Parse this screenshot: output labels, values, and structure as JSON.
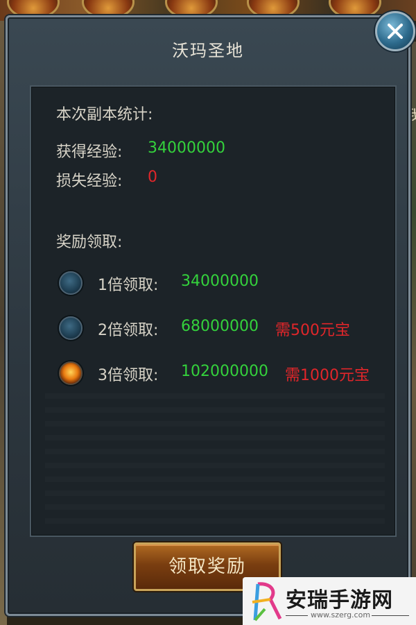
{
  "panel": {
    "title": "沃玛圣地"
  },
  "stats": {
    "heading": "本次副本统计:",
    "gained_label": "获得经验:",
    "gained_value": "34000000",
    "lost_label": "损失经验:",
    "lost_value": "0"
  },
  "rewards": {
    "heading": "奖励领取:",
    "options": [
      {
        "label": "1倍领取:",
        "value": "34000000",
        "cost": "",
        "selected": false
      },
      {
        "label": "2倍领取:",
        "value": "68000000",
        "cost": "需500元宝",
        "selected": false
      },
      {
        "label": "3倍领取:",
        "value": "102000000",
        "cost": "需1000元宝",
        "selected": true
      }
    ]
  },
  "claim_button": {
    "label": "领取奖励"
  },
  "side_text": "我",
  "watermark": {
    "name": "安瑞手游网",
    "url": "www.szerg.com"
  },
  "icons": {
    "close": "close-icon",
    "radio": "radio-icon",
    "logo": "logo-icon"
  }
}
